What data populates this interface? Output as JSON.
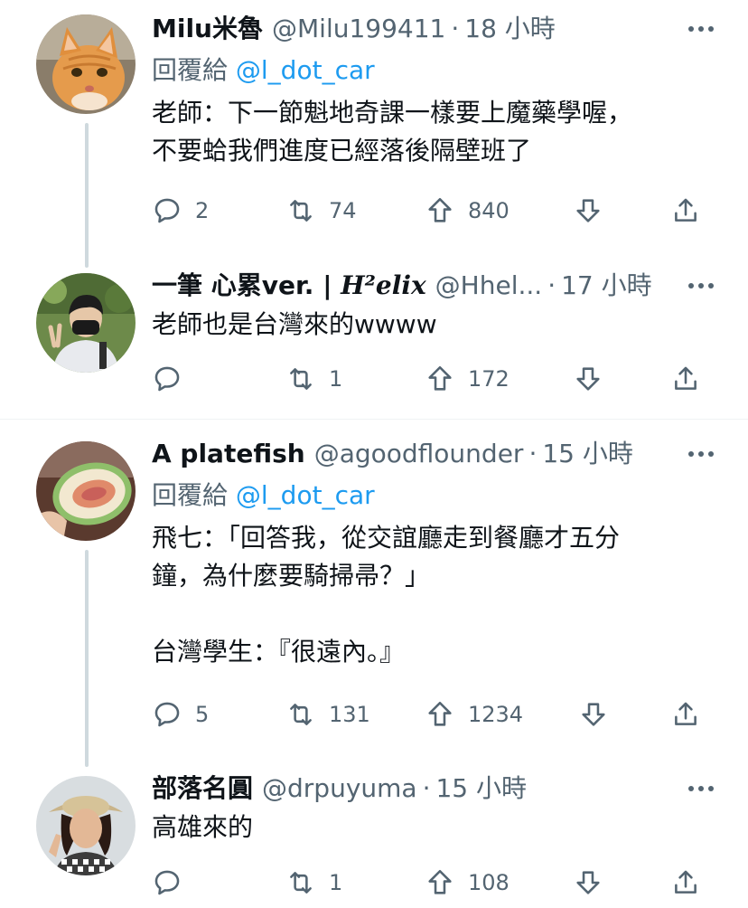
{
  "colors": {
    "text_primary": "#0f1419",
    "text_secondary": "#536471",
    "link": "#1d9bf0",
    "thread_line": "#cfd9de",
    "divider": "#eff3f4"
  },
  "separator": "·",
  "tweets": [
    {
      "display_name": "Milu米魯",
      "handle": "@Milu199411",
      "timestamp": "18 小時",
      "reply_prefix": "回覆給 ",
      "reply_to": "@l_dot_car",
      "text_lines": [
        "老師：下一節魁地奇課一樣要上魔藥學喔，",
        "不要蛤我們進度已經落後隔壁班了"
      ],
      "replies": "2",
      "retweets": "74",
      "upvotes": "840",
      "avatar": "orange-cat"
    },
    {
      "display_name": "一筆 心累ver. | ",
      "display_name_styled": "H²elix",
      "handle": "@Hhel...",
      "timestamp": "17 小時",
      "text_lines": [
        "老師也是台灣來的wwww"
      ],
      "replies": "",
      "retweets": "1",
      "upvotes": "172",
      "avatar": "masked-person"
    },
    {
      "display_name": "A platefish",
      "handle": "@agoodflounder",
      "timestamp": "15 小時",
      "reply_prefix": "回覆給 ",
      "reply_to": "@l_dot_car",
      "text_lines": [
        "飛七：「回答我，從交誼廳走到餐廳才五分",
        "鐘，為什麼要騎掃帚？」",
        "",
        "台灣學生：『很遠內。』"
      ],
      "replies": "5",
      "retweets": "131",
      "upvotes": "1234",
      "avatar": "fruit-half"
    },
    {
      "display_name": "部落名圓",
      "handle": "@drpuyuma",
      "timestamp": "15 小時",
      "text_lines": [
        "高雄來的"
      ],
      "replies": "",
      "retweets": "1",
      "upvotes": "108",
      "avatar": "woman-hat"
    }
  ]
}
